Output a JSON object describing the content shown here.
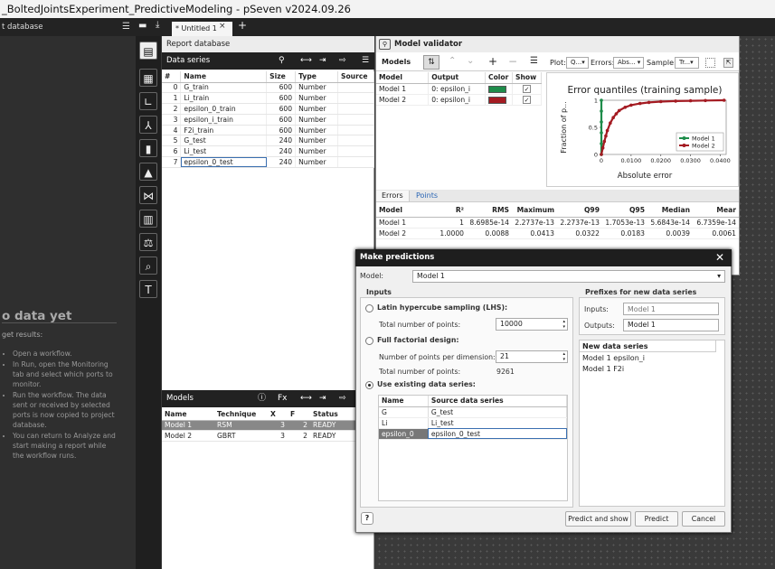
{
  "window": {
    "title": "_BoltedJointsExperiment_PredictiveModeling - pSeven v2024.09.26"
  },
  "left_panel": {
    "header": "t database",
    "no_data_title": "o data yet",
    "get_results": "get results:",
    "steps": [
      "Open a workflow.",
      "In Run, open the Monitoring tab and select which ports to monitor.",
      "Run the workflow. The data sent or received by selected ports is now copied to project database.",
      "You can return to Analyze and start making a report while the workflow runs."
    ]
  },
  "tabs": [
    {
      "label": "* Untitled 1"
    }
  ],
  "report_db": {
    "title": "Report database",
    "data_series_label": "Data series",
    "columns": [
      "#",
      "Name",
      "Size",
      "Type",
      "Source"
    ],
    "rows": [
      {
        "i": "0",
        "name": "G_train",
        "size": "600",
        "type": "Number",
        "source": ""
      },
      {
        "i": "1",
        "name": "Li_train",
        "size": "600",
        "type": "Number",
        "source": ""
      },
      {
        "i": "2",
        "name": "epsilon_0_train",
        "size": "600",
        "type": "Number",
        "source": ""
      },
      {
        "i": "3",
        "name": "epsilon_i_train",
        "size": "600",
        "type": "Number",
        "source": ""
      },
      {
        "i": "4",
        "name": "F2i_train",
        "size": "600",
        "type": "Number",
        "source": ""
      },
      {
        "i": "5",
        "name": "G_test",
        "size": "240",
        "type": "Number",
        "source": ""
      },
      {
        "i": "6",
        "name": "Li_test",
        "size": "240",
        "type": "Number",
        "source": ""
      },
      {
        "i": "7",
        "name": "epsilon_0_test",
        "size": "240",
        "type": "Number",
        "source": ""
      }
    ],
    "models_label": "Models",
    "model_columns": [
      "Name",
      "Technique",
      "X",
      "F",
      "Status"
    ],
    "models": [
      {
        "name": "Model 1",
        "technique": "RSM",
        "x": "3",
        "f": "2",
        "status": "READY"
      },
      {
        "name": "Model 2",
        "technique": "GBRT",
        "x": "3",
        "f": "2",
        "status": "READY"
      }
    ]
  },
  "validator": {
    "title": "Model validator",
    "models_label": "Models",
    "plot_label": "Plot:",
    "plot_value": "Q...",
    "errors_label": "Errors:",
    "errors_value": "Abs...",
    "sample_label": "Sample:",
    "sample_value": "Tr...",
    "columns": [
      "Model",
      "Output",
      "Color",
      "Show"
    ],
    "rows": [
      {
        "model": "Model 1",
        "output": "0: epsilon_i",
        "color": "#1e8c4a"
      },
      {
        "model": "Model 2",
        "output": "0: epsilon_i",
        "color": "#a41b22"
      }
    ],
    "tab_errors": "Errors",
    "tab_points": "Points",
    "err_columns": [
      "Model",
      "R²",
      "RMS",
      "Maximum",
      "Q99",
      "Q95",
      "Median",
      "Mear"
    ],
    "err_rows": [
      [
        "Model 1",
        "1",
        "8.6985e-14",
        "2.2737e-13",
        "2.2737e-13",
        "1.7053e-13",
        "5.6843e-14",
        "6.7359e-14"
      ],
      [
        "Model 2",
        "1.0000",
        "0.0088",
        "0.0413",
        "0.0322",
        "0.0183",
        "0.0039",
        "0.0061"
      ]
    ]
  },
  "chart_data": {
    "type": "line",
    "title": "Error quantiles (training sample)",
    "xlabel": "Absolute error",
    "ylabel": "Fraction of p...",
    "xlim": [
      0,
      0.042
    ],
    "ylim": [
      0,
      1
    ],
    "xticks": [
      "0",
      "0.0100",
      "0.0200",
      "0.0300",
      "0.0400"
    ],
    "yticks": [
      "0",
      "0.5",
      "1"
    ],
    "legend_position": "bottom-right",
    "series": [
      {
        "name": "Model 1",
        "color": "#1e8c4a",
        "x": [
          0,
          0,
          0,
          0,
          0,
          0
        ],
        "y": [
          0,
          0.2,
          0.4,
          0.6,
          0.8,
          1
        ]
      },
      {
        "name": "Model 2",
        "color": "#a41b22",
        "x": [
          0,
          0.0005,
          0.001,
          0.0015,
          0.002,
          0.003,
          0.004,
          0.005,
          0.006,
          0.008,
          0.01,
          0.013,
          0.016,
          0.02,
          0.025,
          0.03,
          0.035,
          0.0413
        ],
        "y": [
          0,
          0.12,
          0.24,
          0.34,
          0.44,
          0.58,
          0.68,
          0.75,
          0.81,
          0.87,
          0.91,
          0.94,
          0.96,
          0.975,
          0.985,
          0.99,
          0.995,
          1
        ]
      }
    ]
  },
  "predict_dialog": {
    "title": "Make predictions",
    "model_label": "Model:",
    "model_value": "Model 1",
    "inputs_label": "Inputs",
    "lhs_label": "Latin hypercube sampling (LHS):",
    "total_points_label": "Total number of points:",
    "total_points_value": "10000",
    "factorial_label": "Full factorial design:",
    "per_dim_label": "Number of points per dimension:",
    "per_dim_value": "21",
    "factorial_total_label": "Total number of points:",
    "factorial_total_value": "9261",
    "existing_label": "Use existing data series:",
    "src_columns": [
      "Name",
      "Source data series"
    ],
    "src_rows": [
      {
        "name": "G",
        "source": "G_test"
      },
      {
        "name": "Li",
        "source": "Li_test"
      },
      {
        "name": "epsilon_0",
        "source": "epsilon_0_test"
      }
    ],
    "prefixes_label": "Prefixes for new data series",
    "inputs_prefix_label": "Inputs:",
    "inputs_prefix_placeholder": "Model 1",
    "outputs_prefix_label": "Outputs:",
    "outputs_prefix_value": "Model 1",
    "new_series_label": "New data series",
    "new_series": [
      "Model 1 epsilon_i",
      "Model 1 F2i"
    ],
    "btn_predict_show": "Predict and show",
    "btn_predict": "Predict",
    "btn_cancel": "Cancel"
  }
}
